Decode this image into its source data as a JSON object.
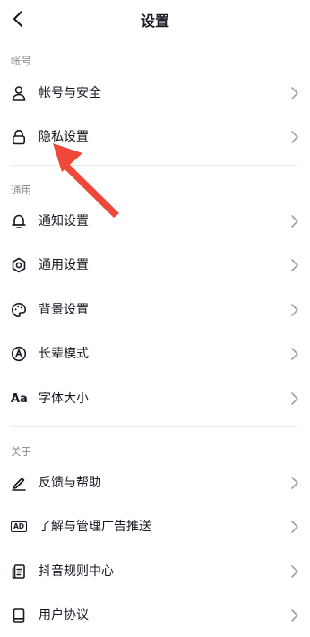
{
  "header": {
    "title": "设置"
  },
  "sections": [
    {
      "title": "帐号",
      "items": [
        {
          "label": "帐号与安全",
          "icon": "user-icon"
        },
        {
          "label": "隐私设置",
          "icon": "lock-icon"
        }
      ]
    },
    {
      "title": "通用",
      "items": [
        {
          "label": "通知设置",
          "icon": "bell-icon"
        },
        {
          "label": "通用设置",
          "icon": "gear-icon"
        },
        {
          "label": "背景设置",
          "icon": "palette-icon"
        },
        {
          "label": "长辈模式",
          "icon": "elder-mode-icon"
        },
        {
          "label": "字体大小",
          "icon": "font-size-icon",
          "icon_text": "Aa"
        }
      ]
    },
    {
      "title": "关于",
      "items": [
        {
          "label": "反馈与帮助",
          "icon": "feedback-pen-icon"
        },
        {
          "label": "了解与管理广告推送",
          "icon": "ad-icon",
          "icon_text": "AD"
        },
        {
          "label": "抖音规则中心",
          "icon": "rules-document-icon"
        },
        {
          "label": "用户协议",
          "icon": "book-icon"
        }
      ]
    }
  ],
  "colors": {
    "text": "#161823",
    "secondary": "#8a8b91",
    "chevron": "#a0a1a6",
    "divider": "#ececec",
    "annotation_arrow": "#f0473b"
  }
}
